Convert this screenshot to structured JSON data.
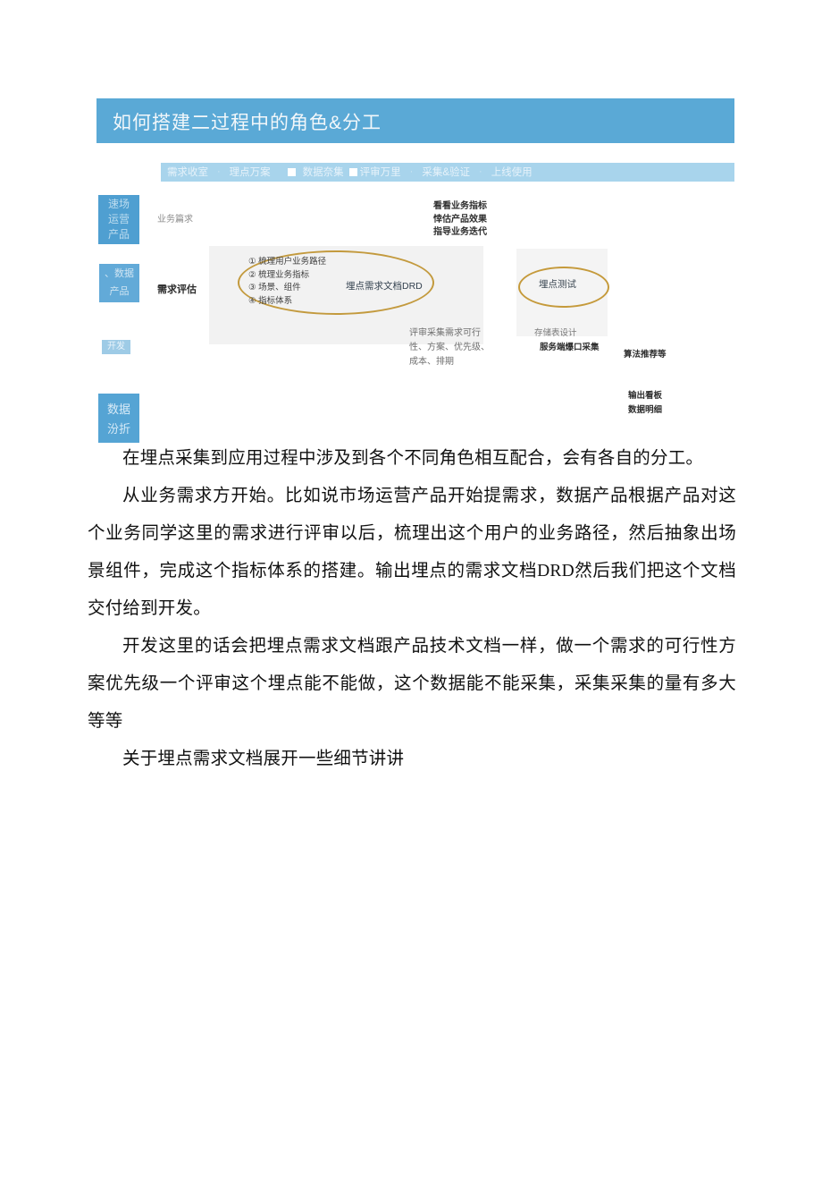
{
  "slide": {
    "title": "如何搭建二过程中的角色&分工",
    "title_bar_color": "#5aa9d6",
    "process_bar_color": "#a8d4ec",
    "process_steps": [
      "需求收室",
      "理点万案",
      "数据奈集",
      "评审万里",
      "采集&验证",
      "上线使用"
    ],
    "process_separator": "·",
    "roles": [
      {
        "label": "速场\n运营\n产品",
        "lines": [
          "速场",
          "运营",
          "产品"
        ],
        "color": "#4f9fd1"
      },
      {
        "label": "、数据 产品",
        "lines": [
          "、数据",
          "产品"
        ],
        "color": "#62aad8"
      },
      {
        "label": "开发",
        "lines": [
          "开发"
        ],
        "color": "#9ecbe6"
      },
      {
        "label": "数据 汾折",
        "lines": [
          "数据",
          "汾折"
        ],
        "color": "#55a4d4"
      }
    ],
    "stage_labels": {
      "business_demand": "业务篇求",
      "demand_review": "需求评估"
    },
    "numbered_list": [
      "① 梳理用户业务路径",
      "② 梳理业务指标",
      "③ 场景、组件",
      "④ 指标体系"
    ],
    "drd_label": "埋点需求文档DRD",
    "test_label": "埋点测试",
    "ellipse_color": "#bf922f",
    "annotations": {
      "top_right": [
        "看看业务指标",
        "悻估产品效果",
        "指导业务迭代"
      ],
      "review": [
        "评审采集需求可行",
        "性、方案、优先级、",
        "成本、排期"
      ],
      "storage_title": "存储表设计",
      "storage_sub": "服务端爆口采集",
      "algorithm": "算法推荐等",
      "output": [
        "输出看板",
        "数据明细"
      ]
    }
  },
  "body": {
    "paragraphs": [
      "在埋点采集到应用过程中涉及到各个不同角色相互配合，会有各自的分工。",
      "从业务需求方开始。比如说市场运营产品开始提需求，数据产品根据产品对这个业务同学这里的需求进行评审以后，梳理出这个用户的业务路径，然后抽象出场景组件，完成这个指标体系的搭建。输出埋点的需求文档DRD然后我们把这个文档交付给到开发。",
      "开发这里的话会把埋点需求文档跟产品技术文档一样，做一个需求的可行性方案优先级一个评审这个埋点能不能做，这个数据能不能采集，采集采集的量有多大等等",
      "关于埋点需求文档展开一些细节讲讲"
    ]
  }
}
